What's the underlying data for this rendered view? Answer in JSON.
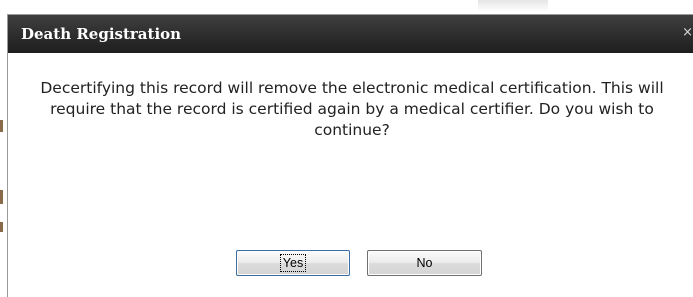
{
  "dialog": {
    "title": "Death Registration",
    "close_label": "×",
    "message": "Decertifying this record will remove the electronic medical certification. This will require that the record is certified again by a medical certifier. Do you wish to continue?",
    "buttons": {
      "yes_label": "Yes",
      "no_label": "No"
    }
  },
  "colors": {
    "titlebar": "#2e2e2e",
    "title_text": "#ffffff",
    "message_text": "#222222",
    "focus_border": "#3a6ea5"
  }
}
